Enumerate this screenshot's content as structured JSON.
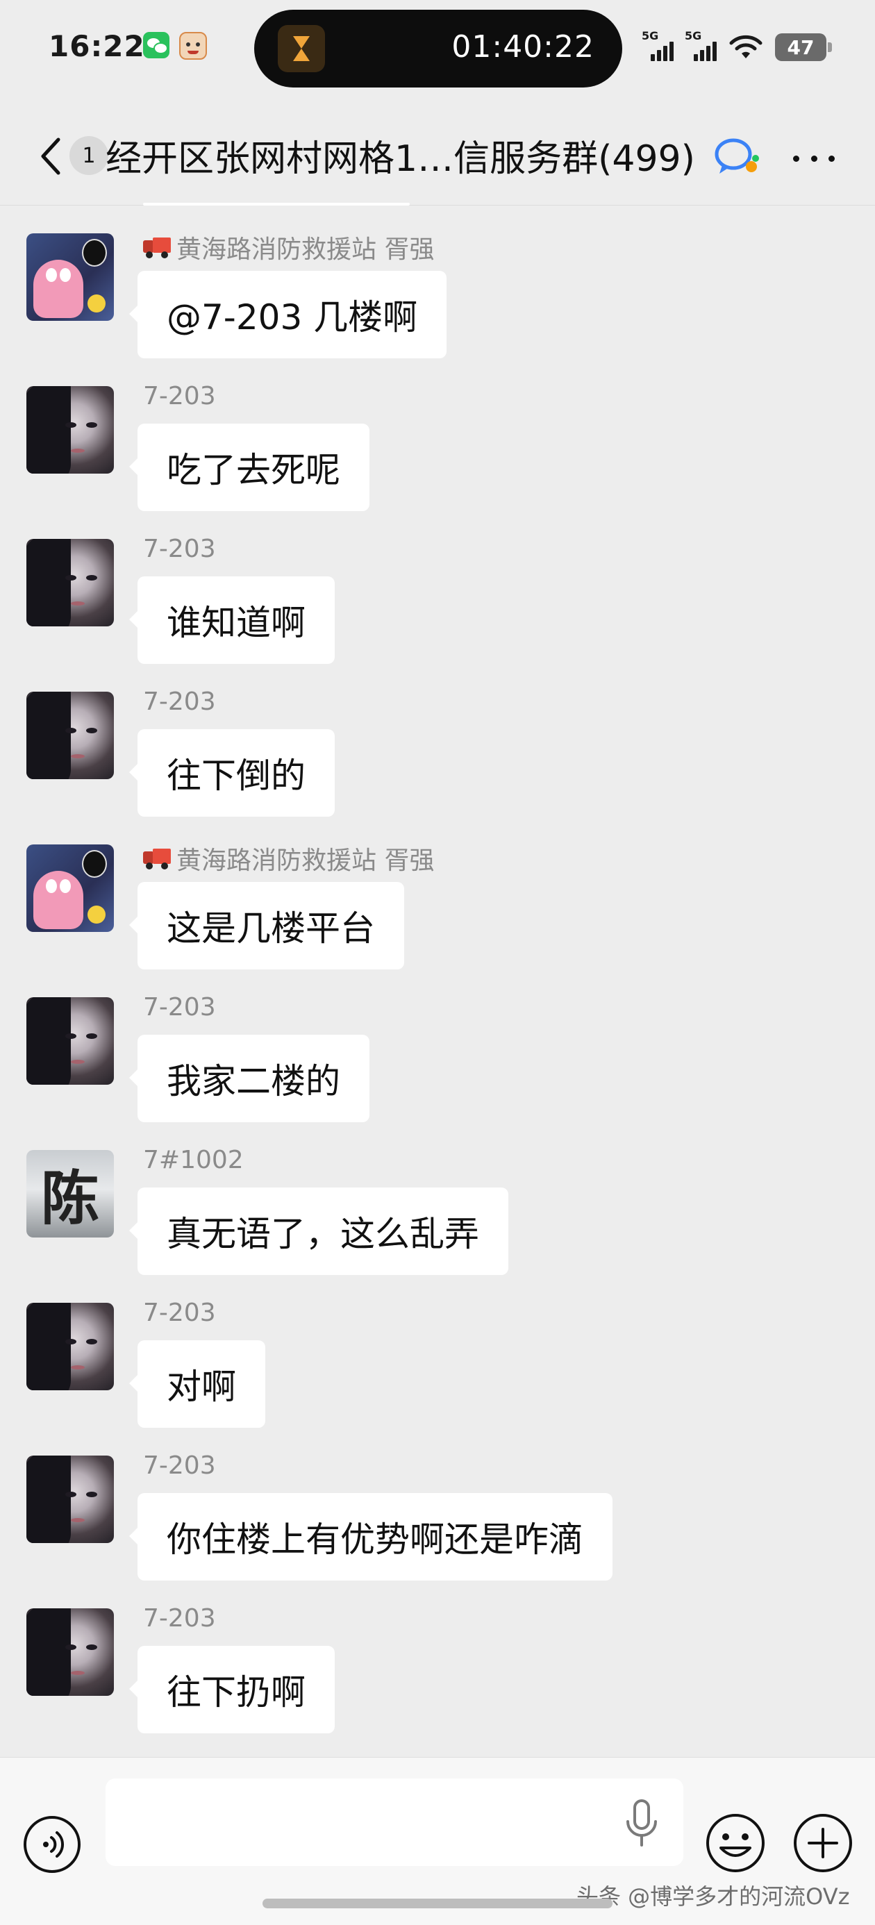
{
  "status_bar": {
    "time": "16:22",
    "island_timer": "01:40:22",
    "signal1_label": "5G",
    "signal2_label": "5G",
    "battery": "47"
  },
  "header": {
    "unread": "1",
    "title": "经开区张网村网格1…信服务群(499)"
  },
  "messages": [
    {
      "sender": "黄海路消防救援站 胥强",
      "text": "@7-203  几楼啊",
      "avatar": "patrick-star",
      "truck": true
    },
    {
      "sender": "7-203",
      "text": "吃了去死呢",
      "avatar": "girl"
    },
    {
      "sender": "7-203",
      "text": "谁知道啊",
      "avatar": "girl"
    },
    {
      "sender": "7-203",
      "text": "往下倒的",
      "avatar": "girl"
    },
    {
      "sender": "黄海路消防救援站 胥强",
      "text": "这是几楼平台",
      "avatar": "patrick-star",
      "truck": true
    },
    {
      "sender": "7-203",
      "text": "我家二楼的",
      "avatar": "girl"
    },
    {
      "sender": "7#1002",
      "text": "真无语了，这么乱弄",
      "avatar": "chen",
      "avatar_char": "陈"
    },
    {
      "sender": "7-203",
      "text": "对啊",
      "avatar": "girl"
    },
    {
      "sender": "7-203",
      "text": "你住楼上有优势啊还是咋滴",
      "avatar": "girl"
    },
    {
      "sender": "7-203",
      "text": "往下扔啊",
      "avatar": "girl"
    }
  ],
  "input": {
    "value": "",
    "placeholder": ""
  },
  "watermark": "头条 @博学多才的河流OVz",
  "colors": {
    "background": "#ededed",
    "bubble": "#ffffff",
    "sender_text": "#8a8a8a"
  }
}
